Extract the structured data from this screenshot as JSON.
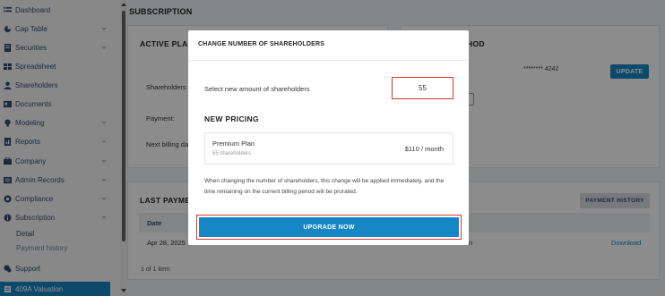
{
  "sidebar": {
    "items": [
      {
        "label": "Dashboard",
        "icon": "dashboard-icon",
        "chevron": false
      },
      {
        "label": "Cap Table",
        "icon": "cap-table-icon",
        "chevron": true
      },
      {
        "label": "Securities",
        "icon": "securities-icon",
        "chevron": true
      },
      {
        "label": "Spreadsheet",
        "icon": "spreadsheet-icon",
        "chevron": false
      },
      {
        "label": "Shareholders",
        "icon": "shareholders-icon",
        "chevron": false
      },
      {
        "label": "Documents",
        "icon": "documents-icon",
        "chevron": false
      },
      {
        "label": "Modeling",
        "icon": "modeling-icon",
        "chevron": true
      },
      {
        "label": "Reports",
        "icon": "reports-icon",
        "chevron": true
      },
      {
        "label": "Company",
        "icon": "company-icon",
        "chevron": true
      },
      {
        "label": "Admin Records",
        "icon": "admin-records-icon",
        "chevron": true
      },
      {
        "label": "Compliance",
        "icon": "compliance-icon",
        "chevron": true
      },
      {
        "label": "Subscription",
        "icon": "subscription-icon",
        "chevron": true
      }
    ],
    "subitems": [
      {
        "label": "Detail"
      },
      {
        "label": "Payment history"
      }
    ],
    "support": {
      "label": "Support",
      "icon": "support-icon"
    },
    "valuation": {
      "label": "409A Valuation",
      "icon": "valuation-icon"
    }
  },
  "main": {
    "page_title": "SUBSCRIPTION",
    "active_plan": {
      "title": "ACTIVE PLAN",
      "shareholders_label": "Shareholders a",
      "payment_label": "Payment:",
      "next_billing_label": "Next billing da"
    },
    "payment_method": {
      "title": "HOD",
      "card_prefix": "r",
      "card_mask": "******** 4242",
      "update_label": "UPDATE"
    },
    "last_payments": {
      "title": "LAST PAYMEN",
      "history_button": "PAYMENT HISTORY",
      "col_date": "Date",
      "row_date": "Apr 28, 2025",
      "row_partial": "n",
      "download_label": "Download",
      "footer": "1 of 1 item"
    }
  },
  "modal": {
    "title": "CHANGE NUMBER OF SHAREHOLDERS",
    "select_label": "Select new amount of shareholders",
    "shareholder_count": "55",
    "pricing_title": "NEW PRICING",
    "plan_name": "Premium Plan",
    "plan_shareholders": "55 shareholders",
    "plan_price": "$110 / month",
    "note": "When changing the number of shareholders, this change will be applied immediately, and the time remaining on the current billing period will be prorated.",
    "upgrade_label": "UPGRADE NOW"
  },
  "colors": {
    "accent": "#1686c4",
    "highlight_border": "#d9342b"
  }
}
